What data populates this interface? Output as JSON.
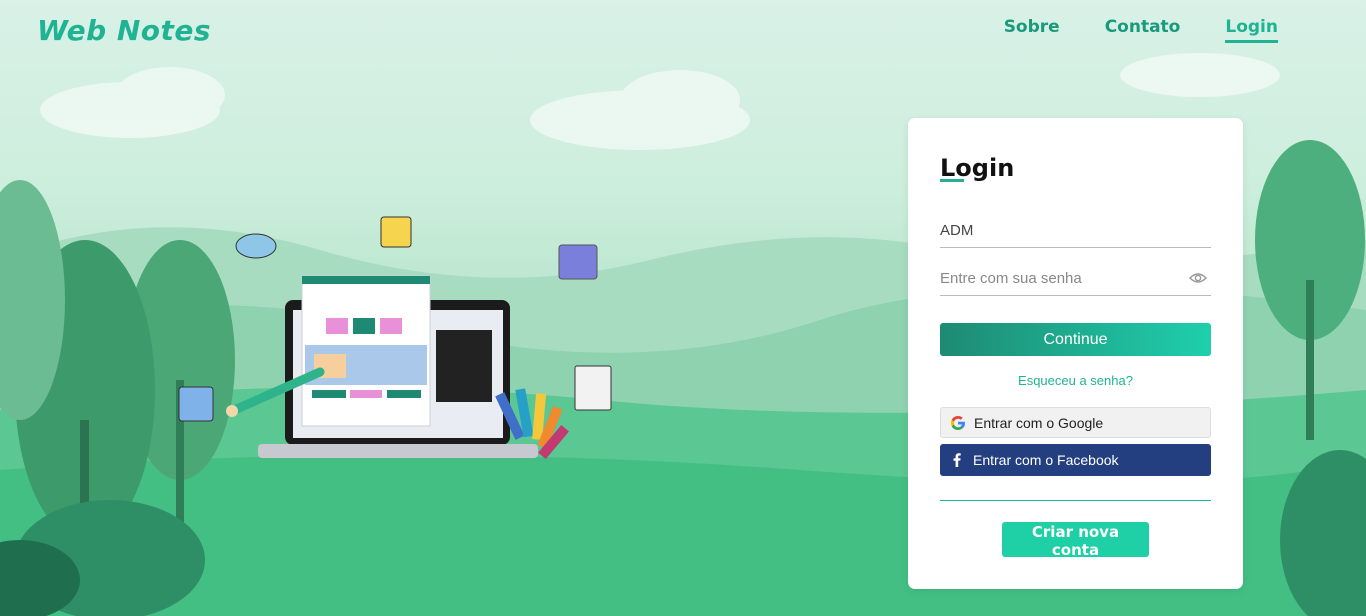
{
  "brand": "Web Notes",
  "nav": {
    "items": [
      {
        "label": "Sobre",
        "active": false
      },
      {
        "label": "Contato",
        "active": false
      },
      {
        "label": "Login",
        "active": true
      }
    ]
  },
  "login": {
    "title": "Login",
    "user_value": "ADM",
    "password_placeholder": "Entre com sua senha",
    "continue_label": "Continue",
    "forgot_label": "Esqueceu a senha?",
    "google_label": "Entrar com o Google",
    "facebook_label": "Entrar com o Facebook",
    "create_label": "Criar nova conta"
  },
  "icons": {
    "eye": "eye-icon",
    "google": "google-icon",
    "facebook": "facebook-icon"
  },
  "colors": {
    "accent": "#1fb393",
    "facebook": "#243f80"
  }
}
